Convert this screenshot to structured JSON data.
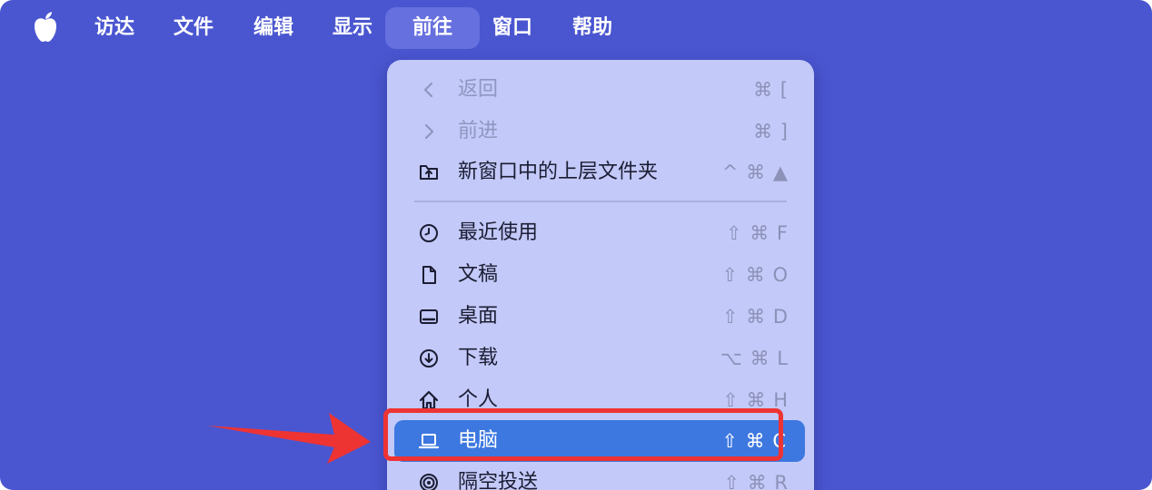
{
  "colors": {
    "desktop": "#4a56d0",
    "menu_bg": "#c3c9f8",
    "highlight": "#3d78e0",
    "annotation": "#ee3333"
  },
  "menubar": {
    "apple_icon": "apple-logo-icon",
    "items": [
      {
        "label": "访达"
      },
      {
        "label": "文件"
      },
      {
        "label": "编辑"
      },
      {
        "label": "显示"
      },
      {
        "label": "前往",
        "active": true
      },
      {
        "label": "窗口"
      },
      {
        "label": "帮助"
      }
    ]
  },
  "go_menu": {
    "items": [
      {
        "label": "返回",
        "shortcut": "⌘ [",
        "icon": "chevron-left-icon",
        "disabled": true
      },
      {
        "label": "前进",
        "shortcut": "⌘ ]",
        "icon": "chevron-right-icon",
        "disabled": true
      },
      {
        "label": "新窗口中的上层文件夹",
        "shortcut": "^ ⌘ ▲",
        "icon": "folder-up-icon"
      },
      {
        "label": "最近使用",
        "shortcut": "⇧ ⌘ F",
        "icon": "clock-icon"
      },
      {
        "label": "文稿",
        "shortcut": "⇧ ⌘ O",
        "icon": "document-icon"
      },
      {
        "label": "桌面",
        "shortcut": "⇧ ⌘ D",
        "icon": "desktop-icon"
      },
      {
        "label": "下载",
        "shortcut": "⌥ ⌘ L",
        "icon": "download-icon"
      },
      {
        "label": "个人",
        "shortcut": "⇧ ⌘ H",
        "icon": "home-icon"
      },
      {
        "label": "电脑",
        "shortcut": "⇧ ⌘ C",
        "icon": "laptop-icon",
        "highlighted": true
      },
      {
        "label": "隔空投送",
        "shortcut": "⇧ ⌘ R",
        "icon": "airdrop-icon"
      }
    ]
  }
}
